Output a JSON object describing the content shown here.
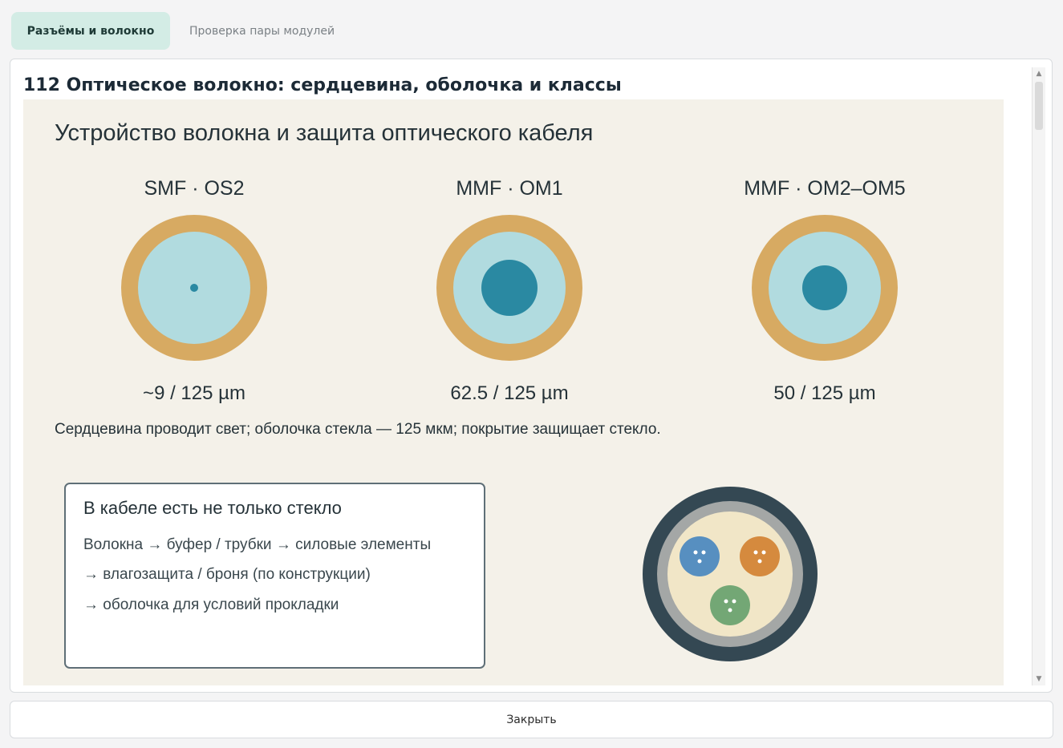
{
  "tabs": [
    {
      "label": "Разъёмы и волокно",
      "active": true
    },
    {
      "label": "Проверка пары модулей",
      "active": false
    }
  ],
  "panel": {
    "title": "112 Оптическое волокно: сердцевина, оболочка и классы"
  },
  "figure": {
    "heading": "Устройство волокна и защита оптического кабеля",
    "fibers": [
      {
        "label": "SMF · OS2",
        "size": "~9 / 125 µm",
        "core_um": 9,
        "cladding_um": 125
      },
      {
        "label": "MMF · OM1",
        "size": "62.5 / 125 µm",
        "core_um": 62.5,
        "cladding_um": 125
      },
      {
        "label": "MMF · OM2–OM5",
        "size": "50 / 125 µm",
        "core_um": 50,
        "cladding_um": 125
      }
    ],
    "caption": "Сердцевина проводит свет; оболочка стекла — 125 мкм; покрытие защищает стекло.",
    "cable_box": {
      "title": "В кабеле есть не только стекло",
      "lines": [
        "Волокна → буфер / трубки → силовые элементы",
        "→ влагозащита / броня (по конструкции)",
        "→ оболочка для условий прокладки"
      ]
    },
    "colors": {
      "coating": "#d7aa62",
      "cladding": "#b1dbdf",
      "core": "#2a89a2",
      "jacket": "#344853",
      "armor": "#a4a7a6",
      "filler": "#f1e6c7",
      "tube_blue": "#578fc0",
      "tube_orange": "#d58a3e",
      "tube_green": "#73a775"
    }
  },
  "footer": {
    "close_label": "Закрыть"
  }
}
